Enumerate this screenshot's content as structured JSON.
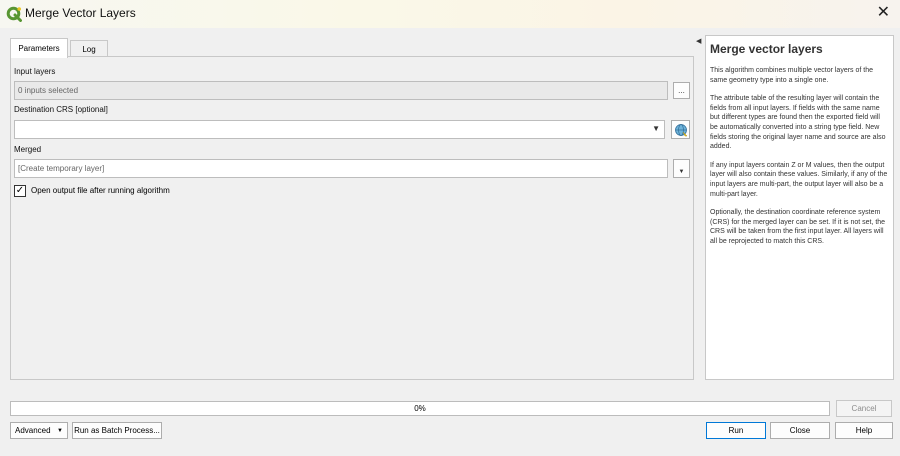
{
  "window": {
    "title": "Merge Vector Layers",
    "icon": "qgis-logo-icon"
  },
  "tabs": [
    {
      "label": "Parameters",
      "active": true
    },
    {
      "label": "Log",
      "active": false
    }
  ],
  "params": {
    "input_layers_label": "Input layers",
    "input_layers_value": "0 inputs selected",
    "input_layers_button": "...",
    "crs_label": "Destination CRS [optional]",
    "crs_value": "",
    "merged_label": "Merged",
    "merged_placeholder": "[Create temporary layer]",
    "open_output_checked": true,
    "open_output_label": "Open output file after running algorithm"
  },
  "help": {
    "title": "Merge vector layers",
    "paragraphs": [
      "This algorithm combines multiple vector layers of the same geometry type into a single one.",
      "The attribute table of the resulting layer will contain the fields from all input layers. If fields with the same name but different types are found then the exported field will be automatically converted into a string type field. New fields storing the original layer name and source are also added.",
      "If any input layers contain Z or M values, then the output layer will also contain these values. Similarly, if any of the input layers are multi-part, the output layer will also be a multi-part layer.",
      "Optionally, the destination coordinate reference system (CRS) for the merged layer can be set. If it is not set, the CRS will be taken from the first input layer. All layers will all be reprojected to match this CRS."
    ]
  },
  "progress": {
    "value": 0,
    "label": "0%"
  },
  "buttons": {
    "cancel": "Cancel",
    "advanced": "Advanced",
    "batch": "Run as Batch Process...",
    "run": "Run",
    "close": "Close",
    "help": "Help"
  },
  "colors": {
    "accent": "#0078d7",
    "qgis_green": "#589632",
    "qgis_yellow": "#ebc621"
  }
}
